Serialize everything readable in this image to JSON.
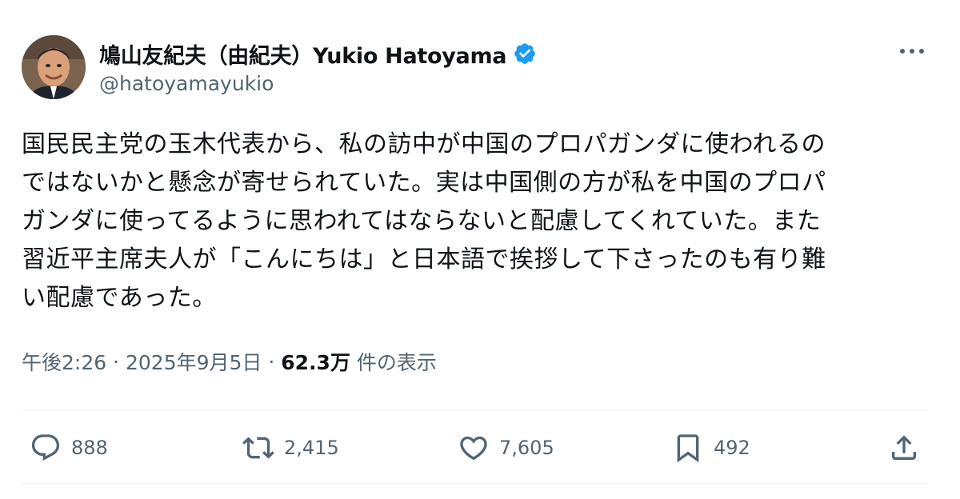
{
  "author": {
    "display_name": "鳩山友紀夫（由紀夫）Yukio Hatoyama",
    "handle": "@hatoyamayukio",
    "verified": true
  },
  "tweet": {
    "text": "国民民主党の玉木代表から、私の訪中が中国のプロパガンダに使われるの\nではないかと懸念が寄せられていた。実は中国側の方が私を中国のプロパ\nガンダに使ってるように思われてはならないと配慮してくれていた。また\n習近平主席夫人が「こんにちは」と日本語で挨拶して下さったのも有り難\nい配慮であった。",
    "time": "午後2:26",
    "separator1": " · ",
    "date": "2025年9月5日",
    "separator2": " · ",
    "views": "62.3万",
    "views_label": " 件の表示"
  },
  "actions": {
    "replies": "888",
    "retweets": "2,415",
    "likes": "7,605",
    "bookmarks": "492"
  },
  "icons": {
    "more": "more-horizontal-icon",
    "verified": "verified-badge-icon",
    "reply": "reply-icon",
    "retweet": "retweet-icon",
    "like": "heart-icon",
    "bookmark": "bookmark-icon",
    "share": "share-icon"
  },
  "colors": {
    "text": "#0f1419",
    "secondary": "#536471",
    "verified": "#1d9bf0",
    "divider": "#eff3f4"
  }
}
